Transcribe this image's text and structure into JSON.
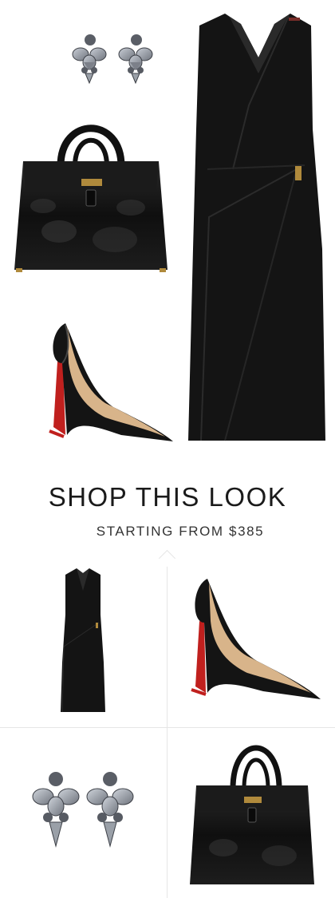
{
  "headline": "SHOP THIS LOOK",
  "subline": "STARTING FROM $385",
  "collage": {
    "items": [
      "earrings-icon",
      "handbag-icon",
      "heels-icon",
      "dress-icon"
    ]
  },
  "products": [
    {
      "name": "dress-icon"
    },
    {
      "name": "heels-icon"
    },
    {
      "name": "earrings-icon"
    },
    {
      "name": "handbag-icon"
    }
  ],
  "colors": {
    "product_black": "#141414",
    "sole_red": "#c0201e",
    "insole_tan": "#d8b48a",
    "stone_gray": "#8e939b",
    "divider": "#e6e6e6"
  }
}
